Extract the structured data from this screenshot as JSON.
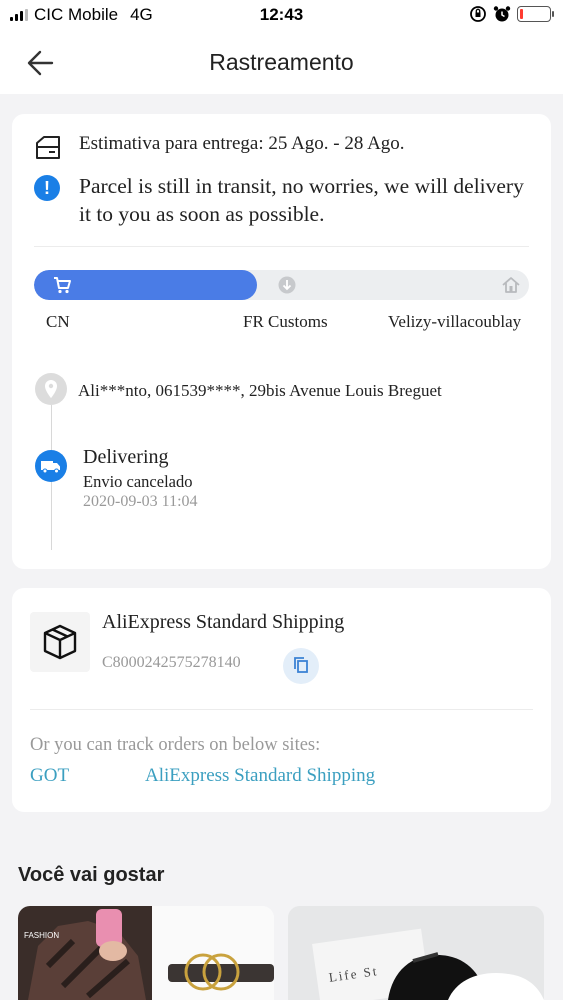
{
  "status_bar": {
    "carrier": "CIC Mobile",
    "network": "4G",
    "time": "12:43",
    "battery_level": 0.1
  },
  "header": {
    "title": "Rastreamento"
  },
  "delivery": {
    "estimate": "Estimativa para entrega: 25 Ago. - 28 Ago.",
    "notice": "Parcel is still in transit, no worries, we will delivery it to you as soon as possible."
  },
  "progress": {
    "fraction": 0.45,
    "stops": [
      "CN",
      "FR Customs",
      "Velizy-villacoublay"
    ]
  },
  "recipient": {
    "address": "Ali***nto,  061539****,  29bis Avenue Louis Breguet"
  },
  "event": {
    "title": "Delivering",
    "subtitle": "Envio cancelado",
    "time": "2020-09-03 11:04"
  },
  "shipping": {
    "method": "AliExpress Standard Shipping",
    "tracking_number": "C8000242575278140",
    "other_sites_label": "Or you can track orders on below sites:",
    "links": [
      "GOT",
      "AliExpress Standard Shipping"
    ]
  },
  "recommendations": {
    "title": "Você vai gostar",
    "product1_badge": "FASHION",
    "product2_caption": "Life St"
  },
  "colors": {
    "accent_blue": "#4a7ce6",
    "link": "#3b9fc0",
    "info_blue": "#1a7fe6"
  }
}
